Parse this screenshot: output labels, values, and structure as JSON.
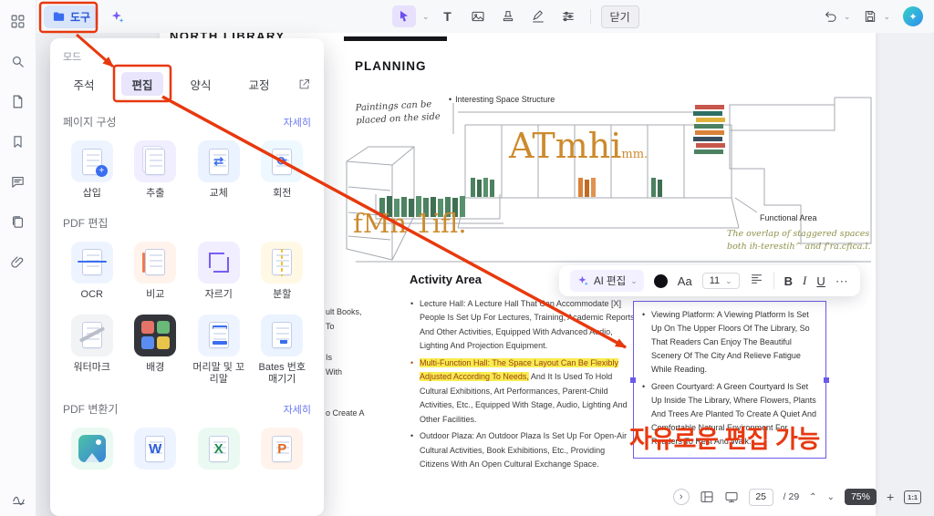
{
  "colors": {
    "annotation_red": "#e8380d",
    "selection_purple": "#6a5ae8",
    "link_blue": "#6877f2",
    "edited_orange": "#cd8a2c",
    "highlight_yellow": "#f8ec4f"
  },
  "icons": {
    "chevron_down": "⌄",
    "chevron_up": "⌃",
    "chevron_right": "›",
    "more_h": "⋯",
    "plus": "+",
    "tool_T": "T",
    "bullet": "•",
    "spark": "✦",
    "word_glyph": "W",
    "excel_glyph": "X",
    "ppt_glyph": "P",
    "swap_glyph": "⇄",
    "rotate_glyph": "⟳"
  },
  "topbar": {
    "tools_label": "도구",
    "close_label": "닫기"
  },
  "panel": {
    "mode_label": "모드",
    "modes": [
      "주석",
      "편집",
      "양식",
      "교정"
    ],
    "page_section": {
      "title": "페이지 구성",
      "more": "자세히"
    },
    "page_items": [
      "삽입",
      "추출",
      "교체",
      "회전"
    ],
    "edit_section": {
      "title": "PDF 편집"
    },
    "edit_items": [
      "OCR",
      "비교",
      "자르기",
      "분할",
      "워터마크",
      "배경",
      "머리말 및 꼬리말",
      "Bates 번호 매기기"
    ],
    "convert_section": {
      "title": "PDF 변환기",
      "more": "자세히"
    }
  },
  "document": {
    "title": "NORTH LIBRARY",
    "heading": "PLANNING",
    "paintings_note_1": "Paintings can be",
    "paintings_note_2": "placed on the side",
    "structure_note": "Interesting Space Structure",
    "edited_word_large": "ATmhi",
    "edited_word_large_tail": "mm.",
    "edited_word_small": "fMn 1ifl.",
    "functional_label": "Functional Area",
    "staggered_note_1": "The overlap of staggered spaces",
    "staggered_note_2": "both ih-terestih^ and f'ra.cfica.l.",
    "activity_heading": "Activity Area",
    "lecture_bullet": "Lecture Hall: A Lecture Hall That Can Accommodate [X] People Is Set Up For Lectures, Training, Academic Reports And Other Activities, Equipped With Advanced Audio, Lighting And Projection Equipment.",
    "multi_bullet_highlight": "Multi-Function Hall: The Space Layout Can Be Flexibly Adjusted According To Needs,",
    "multi_bullet_rest": " And It Is Used To Hold Cultural Exhibitions, Art Performances, Parent-Child Activities, Etc., Equipped With Stage, Audio, Lighting And Other Facilities.",
    "outdoor_bullet": "Outdoor Plaza: An Outdoor Plaza Is Set Up For Open-Air Cultural Activities, Book Exhibitions, Etc., Providing Citizens With An Open Cultural Exchange Space.",
    "fragment_1": "ult Books,",
    "fragment_2": "To",
    "fragment_3": "Is",
    "fragment_4": "With",
    "fragment_5": "o Create A"
  },
  "textbox": {
    "bullet1": "Viewing Platform: A Viewing Platform Is Set Up On The Upper Floors Of The Library, So That Readers Can Enjoy The Beautiful Scenery Of The City And Relieve Fatigue While Reading.",
    "bullet2": "Green Courtyard: A Green Courtyard Is Set Up Inside The Library, Where Flowers, Plants And Trees Are Planted To Create A Quiet And Comfortable Natural Environment For Readers To Rest And Walk."
  },
  "annotation": {
    "caption": "자유로운 편집 가능"
  },
  "format_toolbar": {
    "ai_label": "AI 편집",
    "font_label": "Aa",
    "size_value": "11",
    "bold": "B",
    "italic": "I",
    "underline": "U"
  },
  "statusbar": {
    "page_current": "25",
    "page_total": "/ 29",
    "zoom": "75%",
    "fit_label": "1:1"
  }
}
